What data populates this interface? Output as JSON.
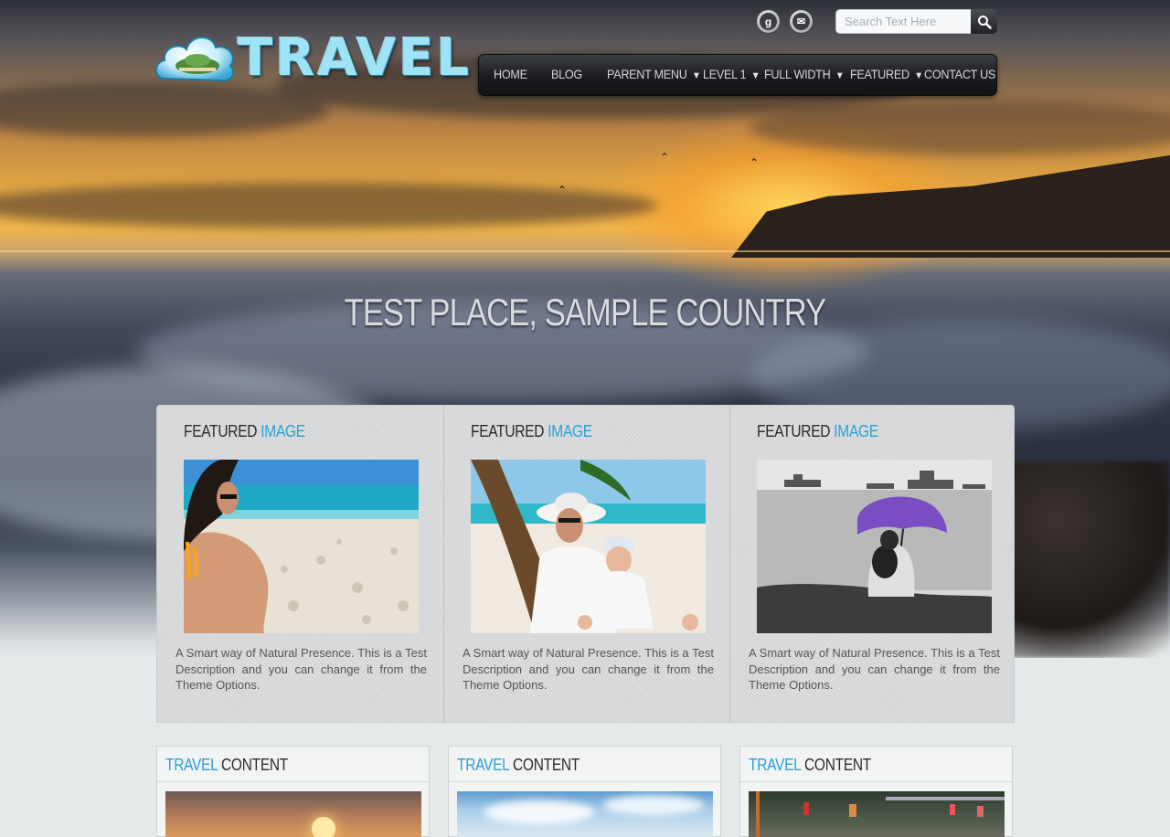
{
  "header": {
    "logo_text": "TRAVEL",
    "social": [
      {
        "name": "google-plus-icon",
        "glyph": "g"
      },
      {
        "name": "email-icon",
        "glyph": "✉"
      }
    ],
    "search": {
      "placeholder": "Search Text Here"
    }
  },
  "nav": {
    "items": [
      {
        "label": "HOME",
        "dropdown": false
      },
      {
        "label": "BLOG",
        "dropdown": false
      },
      {
        "label": "PARENT MENU",
        "dropdown": true
      },
      {
        "label": "LEVEL 1",
        "dropdown": true
      },
      {
        "label": "FULL WIDTH",
        "dropdown": true
      },
      {
        "label": "FEATURED",
        "dropdown": true
      },
      {
        "label": "CONTACT US",
        "dropdown": false
      }
    ]
  },
  "hero": {
    "title": "TEST PLACE, SAMPLE COUNTRY"
  },
  "featured": {
    "items": [
      {
        "title_a": "FEATURED",
        "title_b": "IMAGE",
        "description": "A Smart way of Natural Presence. This is a Test Description and you can change it from the Theme Options."
      },
      {
        "title_a": "FEATURED",
        "title_b": "IMAGE",
        "description": "A Smart way of Natural Presence. This is a Test Description and you can change it from the Theme Options."
      },
      {
        "title_a": "FEATURED",
        "title_b": "IMAGE",
        "description": "A Smart way of Natural Presence. This is a Test Description and you can change it from the Theme Options."
      }
    ]
  },
  "content_cards": [
    {
      "title_a": "TRAVEL",
      "title_b": "CONTENT"
    },
    {
      "title_a": "TRAVEL",
      "title_b": "CONTENT"
    },
    {
      "title_a": "TRAVEL",
      "title_b": "CONTENT"
    }
  ],
  "colors": {
    "accent": "#2aa0d3",
    "nav_bg": "#1b1c1f",
    "panel_bg": "#d8d9db"
  }
}
